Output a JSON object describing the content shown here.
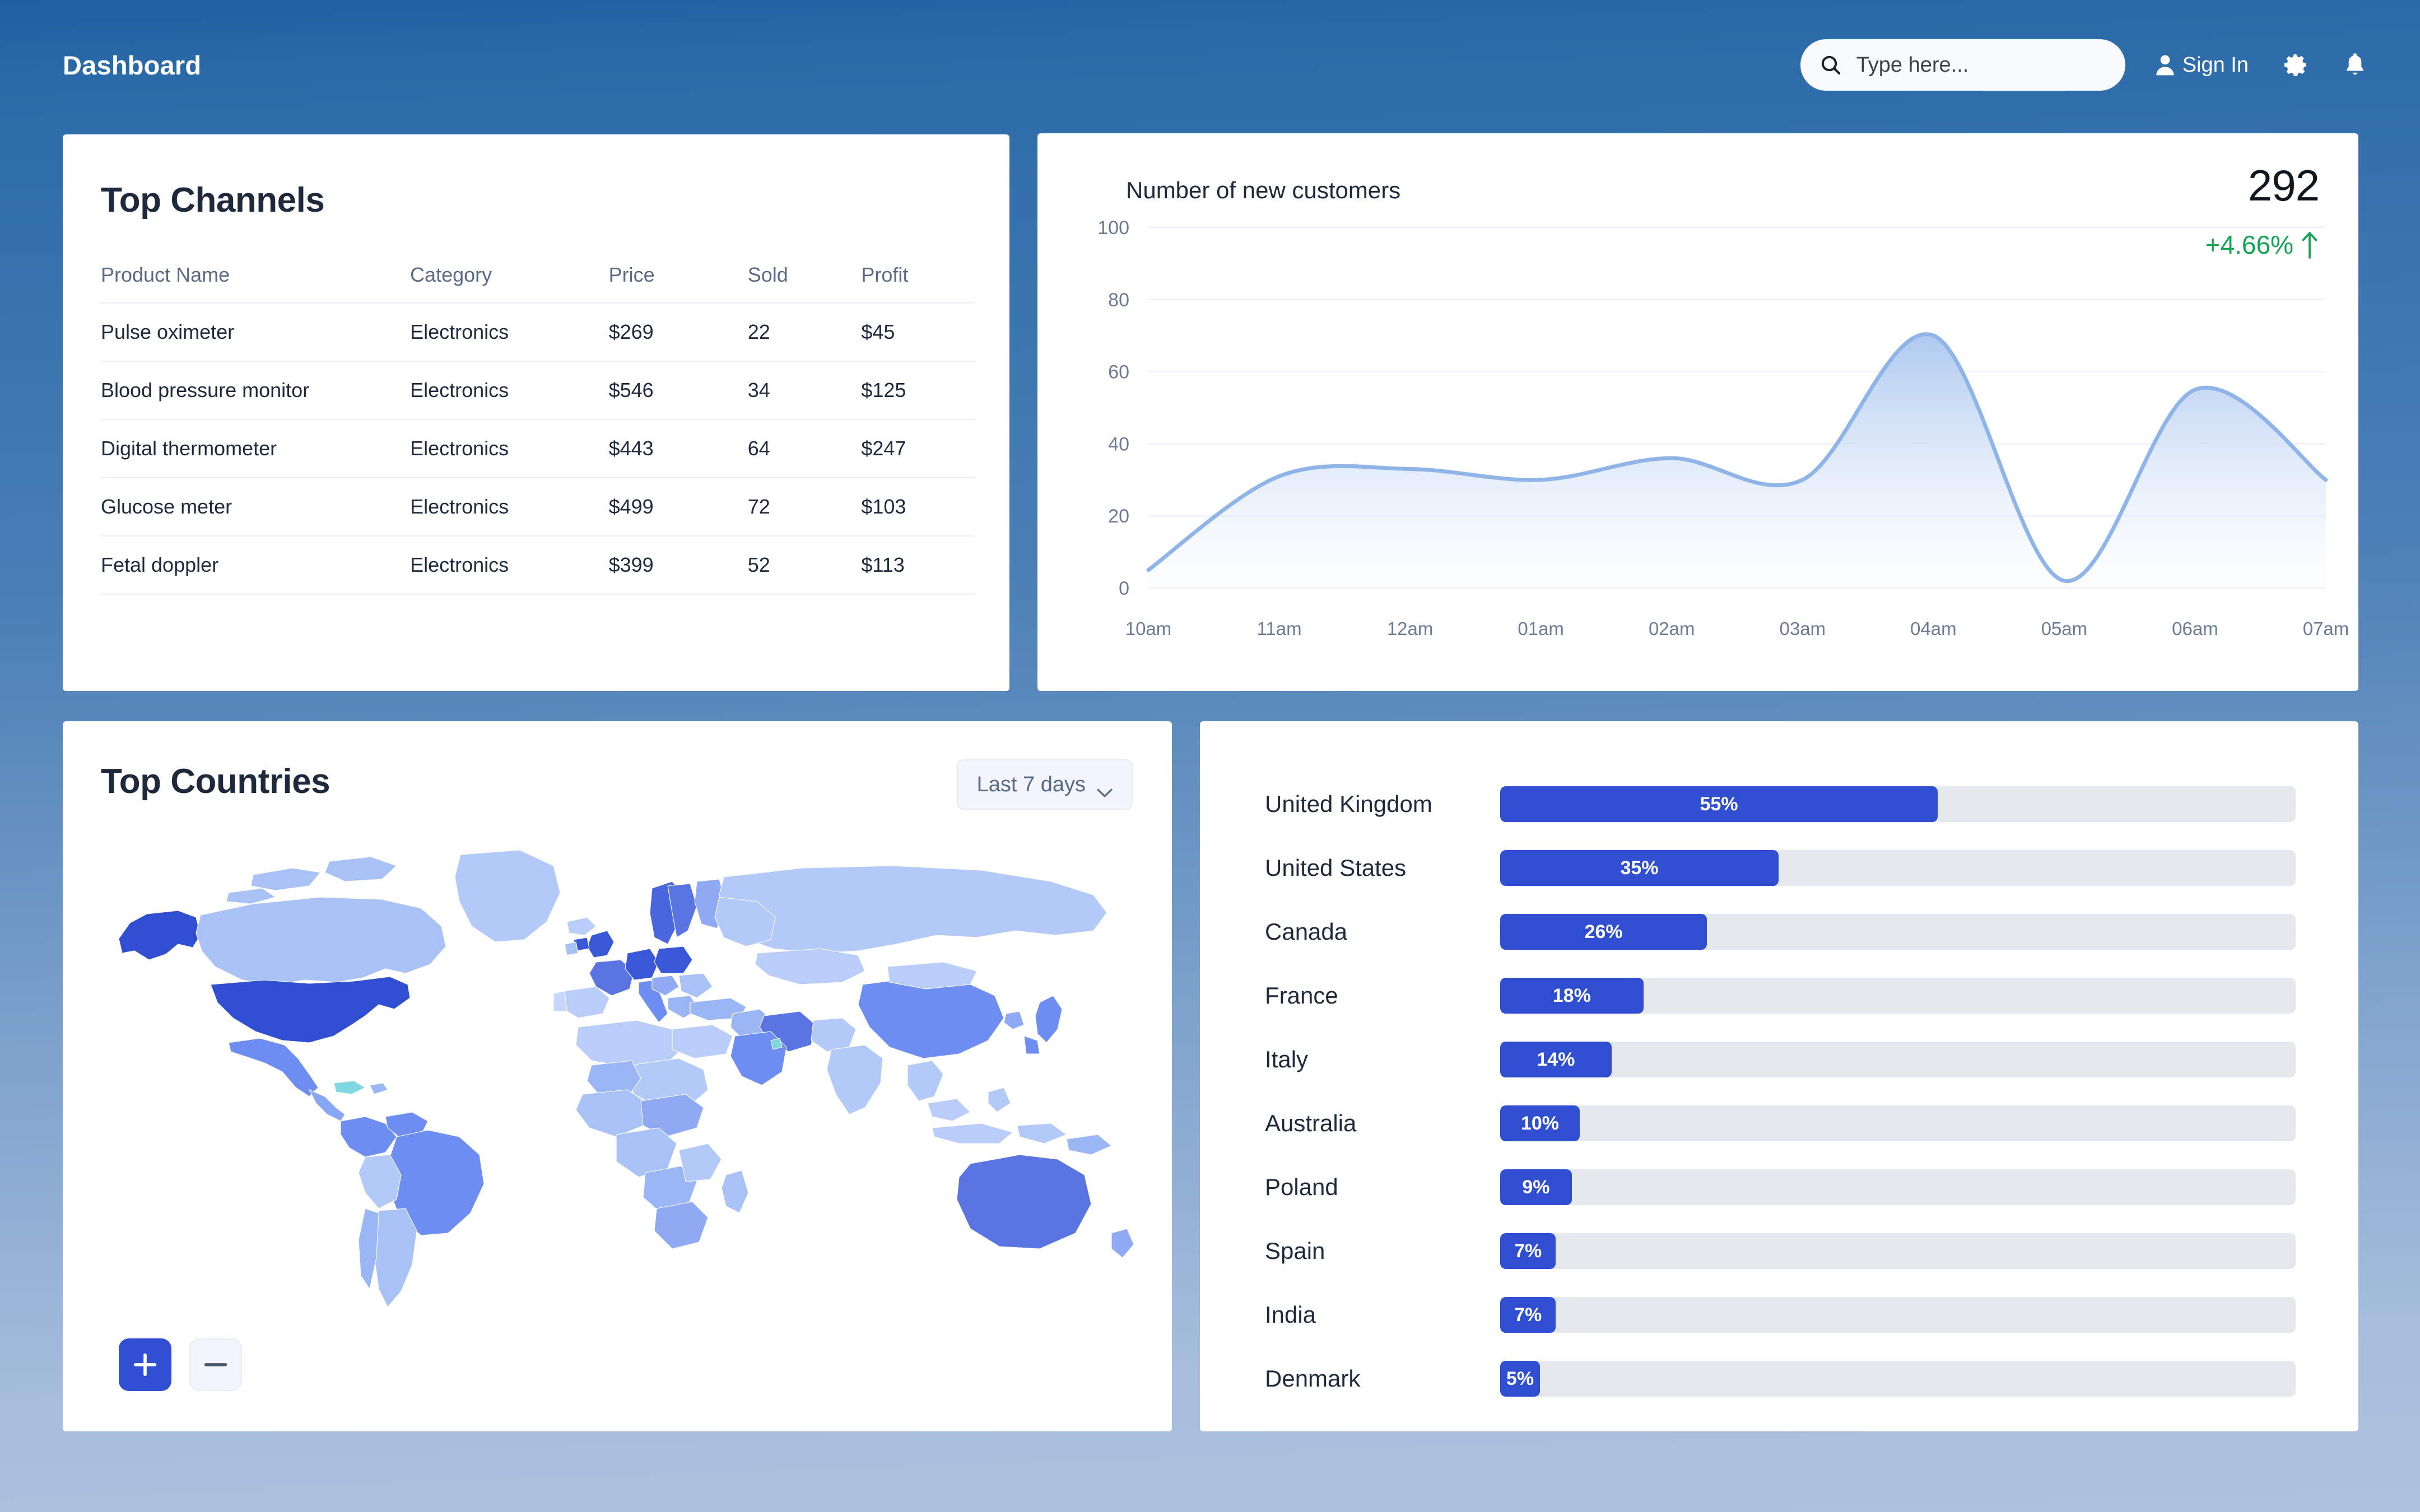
{
  "header": {
    "brand": "Dashboard",
    "search": {
      "placeholder": "Type here...",
      "icon": "search-icon"
    },
    "sign_in": {
      "label": "Sign In",
      "icon": "person-icon"
    },
    "settings_icon": "gear-icon",
    "notifications_icon": "bell-icon"
  },
  "channels": {
    "title": "Top Channels",
    "columns": [
      "Product Name",
      "Category",
      "Price",
      "Sold",
      "Profit"
    ],
    "rows": [
      {
        "name": "Pulse oximeter",
        "category": "Electronics",
        "price": "$269",
        "sold": "22",
        "profit": "$45"
      },
      {
        "name": "Blood pressure monitor",
        "category": "Electronics",
        "price": "$546",
        "sold": "34",
        "profit": "$125"
      },
      {
        "name": "Digital thermometer",
        "category": "Electronics",
        "price": "$443",
        "sold": "64",
        "profit": "$247"
      },
      {
        "name": "Glucose meter",
        "category": "Electronics",
        "price": "$499",
        "sold": "72",
        "profit": "$103"
      },
      {
        "name": "Fetal doppler",
        "category": "Electronics",
        "price": "$399",
        "sold": "52",
        "profit": "$113"
      }
    ],
    "profit_color": "#00b96b"
  },
  "customers_chart": {
    "title": "Number of new customers",
    "value": "292",
    "delta": "+4.66%",
    "delta_color": "#12a454",
    "delta_direction": "up"
  },
  "chart_data": {
    "type": "area",
    "title": "Number of new customers",
    "xlabel": "",
    "ylabel": "",
    "ylim": [
      0,
      100
    ],
    "yticks": [
      0,
      20,
      40,
      60,
      80,
      100
    ],
    "categories": [
      "10am",
      "11am",
      "12am",
      "01am",
      "02am",
      "03am",
      "04am",
      "05am",
      "06am",
      "07am"
    ],
    "values": [
      5,
      31,
      33,
      30,
      36,
      30,
      70,
      2,
      55,
      30
    ],
    "grid": true,
    "legend": "none",
    "line_color": "#8fb4e8",
    "fill": "gradient",
    "annotations": [
      {
        "text": "292",
        "position": "top-right"
      },
      {
        "text": "+4.66%",
        "position": "top-right"
      }
    ]
  },
  "map_panel": {
    "title": "Top Countries",
    "date_range": "Last 7 days",
    "zoom_in_label": "+",
    "zoom_out_label": "−",
    "zoom_in_icon": "plus-icon",
    "zoom_out_icon": "minus-icon",
    "chevron_icon": "chevron-down-icon"
  },
  "countries_chart": {
    "type": "bar",
    "orientation": "horizontal",
    "title": "Top Countries",
    "categories": [
      "United Kingdom",
      "United States",
      "Canada",
      "France",
      "Italy",
      "Australia",
      "Poland",
      "Spain",
      "India",
      "Denmark"
    ],
    "values": [
      55,
      35,
      26,
      18,
      14,
      10,
      9,
      7,
      7,
      5
    ],
    "labels": [
      "55%",
      "35%",
      "26%",
      "18%",
      "14%",
      "10%",
      "9%",
      "7%",
      "7%",
      "5%"
    ],
    "xlim": [
      0,
      100
    ],
    "bar_color": "#2f4fd0",
    "track_color": "#e4e7ec"
  },
  "theme": {
    "accent": "#2f4fd0",
    "header_bg": "#2a6aa8",
    "card_bg": "#ffffff",
    "text_dark": "#1e2a3b",
    "text_muted": "#5a6a85"
  }
}
